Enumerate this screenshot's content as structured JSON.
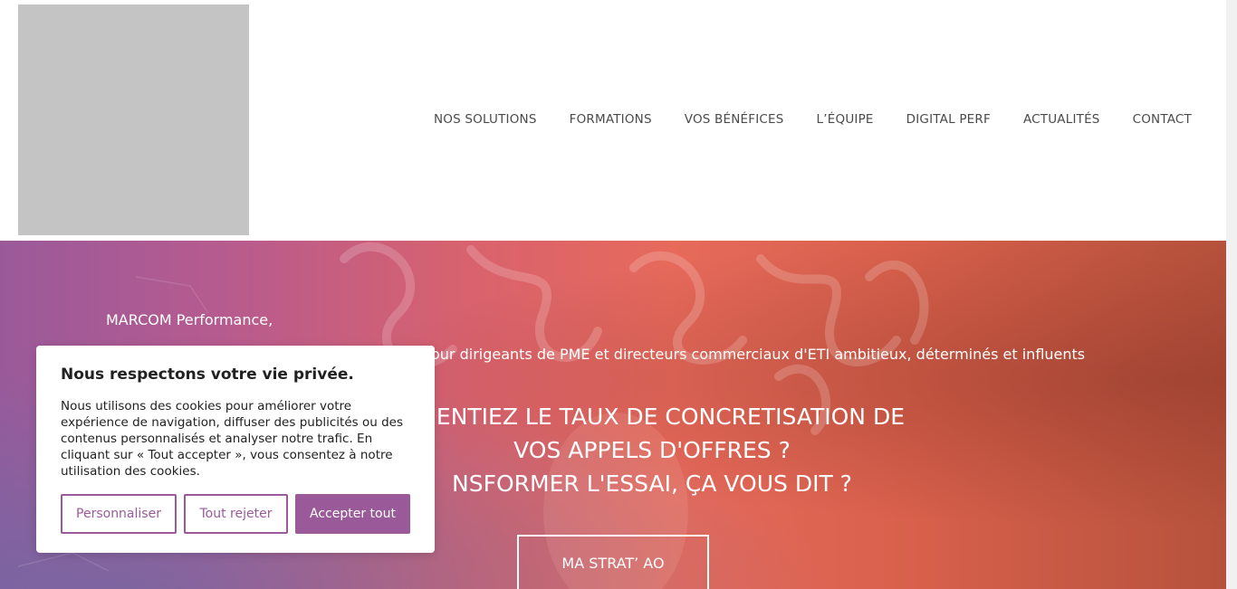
{
  "header": {
    "logo_alt": "",
    "nav": [
      {
        "label": "NOS SOLUTIONS"
      },
      {
        "label": "FORMATIONS"
      },
      {
        "label": "VOS BÉNÉFICES"
      },
      {
        "label": "L’ÉQUIPE"
      },
      {
        "label": "DIGITAL PERF"
      },
      {
        "label": "ACTUALITÉS"
      },
      {
        "label": "CONTACT"
      }
    ]
  },
  "hero": {
    "brand_line": "MARCOM Performance,",
    "subtitle": "our dirigeants de PME et directeurs commerciaux d'ETI ambitieux, déterminés et influents",
    "headline_1": "GMENTIEZ LE TAUX DE CONCRETISATION DE",
    "headline_2": "VOS APPELS D'OFFRES ?",
    "headline_3": "NSFORMER L'ESSAI, ÇA VOUS DIT ?",
    "cta_label": "MA STRAT’ AO"
  },
  "cookie_banner": {
    "title": "Nous respectons votre vie privée.",
    "body": "Nous utilisons des cookies pour améliorer votre expérience de navigation, diffuser des publicités ou des contenus personnalisés et analyser notre trafic. En cliquant sur « Tout accepter », vous consentez à notre utilisation des cookies.",
    "customize_label": "Personnaliser",
    "reject_label": "Tout rejeter",
    "accept_label": "Accepter tout"
  },
  "colors": {
    "accent": "#9a5a9a",
    "hero_left": "#9a5a9a",
    "hero_right": "#b6523c"
  }
}
